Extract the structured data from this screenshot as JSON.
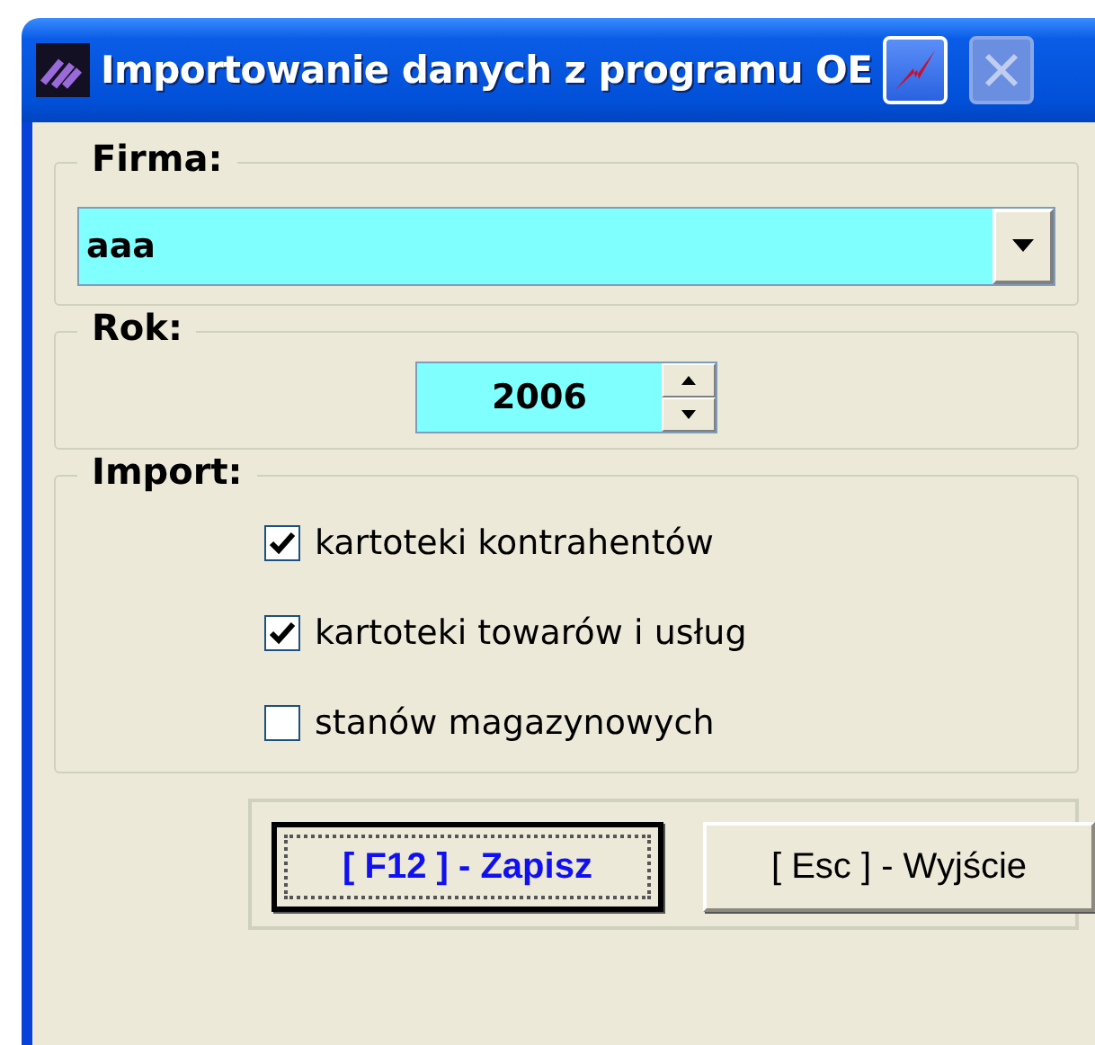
{
  "window": {
    "title": "Importowanie danych z programu OE"
  },
  "firma": {
    "label": "Firma:",
    "value": "aaa"
  },
  "rok": {
    "label": "Rok:",
    "value": "2006"
  },
  "import": {
    "label": "Import:",
    "options": [
      {
        "label": "kartoteki kontrahentów",
        "checked": true
      },
      {
        "label": "kartoteki towarów i usług",
        "checked": true
      },
      {
        "label": "stanów magazynowych",
        "checked": false
      }
    ]
  },
  "buttons": [
    {
      "label": "[ F12 ] - Zapisz",
      "focused": true
    },
    {
      "label": "[ Esc ] - Wyjście",
      "focused": false
    }
  ]
}
